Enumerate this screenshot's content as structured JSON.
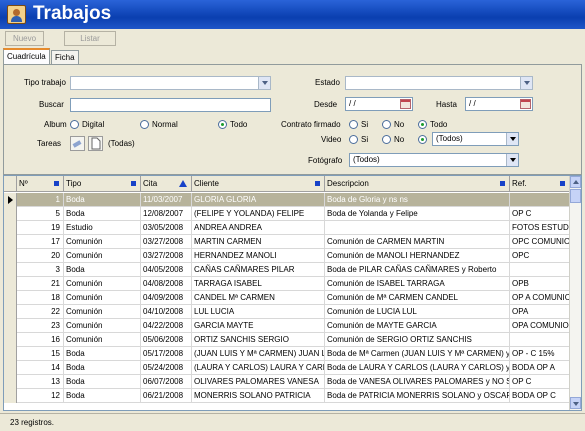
{
  "window": {
    "title": "Trabajos"
  },
  "toolbar": {
    "nuevo": "Nuevo",
    "listar": "Listar"
  },
  "tabs": [
    {
      "label": "Cuadrícula",
      "active": true
    },
    {
      "label": "Ficha",
      "active": false
    }
  ],
  "filters": {
    "tipo_trabajo_label": "Tipo trabajo",
    "tipo_trabajo_value": "",
    "estado_label": "Estado",
    "estado_value": "",
    "buscar_label": "Buscar",
    "buscar_value": "",
    "desde_label": "Desde",
    "desde_value": "/ /",
    "hasta_label": "Hasta",
    "hasta_value": "/ /",
    "album_label": "Album",
    "album_options": [
      "Digital",
      "Normal",
      "Todo"
    ],
    "album_selected": "Todo",
    "contrato_label": "Contrato firmado",
    "contrato_options": [
      "Si",
      "No",
      "Todo"
    ],
    "contrato_selected": "Todo",
    "video_label": "Video",
    "video_options": [
      "Si",
      "No"
    ],
    "video_select_value": "(Todos)",
    "tareas_label": "Tareas",
    "tareas_value": "(Todas)",
    "fotografo_label": "Fotógrafo",
    "fotografo_value": "(Todos)"
  },
  "grid": {
    "headers": [
      "Nº",
      "Tipo",
      "Cita",
      "Cliente",
      "Descripcion",
      "Ref."
    ],
    "sort_column": "Cita",
    "rows": [
      {
        "n": "1",
        "tipo": "Boda",
        "cita": "11/03/2007",
        "cliente": "GLORIA GLORIA",
        "desc": "Boda de Gloria  y ns ns",
        "ref": "",
        "selected": true
      },
      {
        "n": "5",
        "tipo": "Boda",
        "cita": "12/08/2007",
        "cliente": "(FELIPE Y YOLANDA) FELIPE",
        "desc": "Boda de Yolanda  y Felipe",
        "ref": "OP C"
      },
      {
        "n": "19",
        "tipo": "Estudio",
        "cita": "03/05/2008",
        "cliente": "ANDREA ANDREA",
        "desc": "",
        "ref": "FOTOS ESTUDIO"
      },
      {
        "n": "17",
        "tipo": "Comunión",
        "cita": "03/27/2008",
        "cliente": "MARTIN CARMEN",
        "desc": "Comunión de CARMEN MARTIN",
        "ref": "OPC COMUNIO"
      },
      {
        "n": "20",
        "tipo": "Comunión",
        "cita": "03/27/2008",
        "cliente": "HERNANDEZ MANOLI",
        "desc": "Comunión de MANOLI HERNANDEZ",
        "ref": "OPC"
      },
      {
        "n": "3",
        "tipo": "Boda",
        "cita": "04/05/2008",
        "cliente": "CAÑAS CAÑMARES PILAR",
        "desc": "Boda de PILAR CAÑAS CAÑMARES y Roberto",
        "ref": ""
      },
      {
        "n": "21",
        "tipo": "Comunión",
        "cita": "04/08/2008",
        "cliente": "TARRAGA ISABEL",
        "desc": "Comunión de ISABEL TARRAGA",
        "ref": "OPB"
      },
      {
        "n": "18",
        "tipo": "Comunión",
        "cita": "04/09/2008",
        "cliente": "CANDEL Mª CARMEN",
        "desc": "Comunión de Mª CARMEN CANDEL",
        "ref": "OP A COMUNIC"
      },
      {
        "n": "22",
        "tipo": "Comunión",
        "cita": "04/10/2008",
        "cliente": "LUL LUCIA",
        "desc": "Comunión de LUCIA LUL",
        "ref": "OPA"
      },
      {
        "n": "23",
        "tipo": "Comunión",
        "cita": "04/22/2008",
        "cliente": "GARCIA MAYTE",
        "desc": "Comunión de MAYTE GARCIA",
        "ref": "OPA  COMUNIO"
      },
      {
        "n": "16",
        "tipo": "Comunión",
        "cita": "05/06/2008",
        "cliente": "ORTIZ SANCHIS SERGIO",
        "desc": "Comunión de SERGIO ORTIZ SANCHIS",
        "ref": ""
      },
      {
        "n": "15",
        "tipo": "Boda",
        "cita": "05/17/2008",
        "cliente": "(JUAN LUIS Y Mª CARMEN) JUAN LU",
        "desc": "Boda de Mª Carmen (JUAN LUIS Y Mª CARMEN) y Ju",
        "ref": "OP - C 15%"
      },
      {
        "n": "14",
        "tipo": "Boda",
        "cita": "05/24/2008",
        "cliente": "(LAURA Y CARLOS) LAURA Y CARL",
        "desc": "Boda de LAURA Y CARLOS (LAURA Y CARLOS) y",
        "ref": "BODA OP A"
      },
      {
        "n": "13",
        "tipo": "Boda",
        "cita": "06/07/2008",
        "cliente": "OLIVARES PALOMARES VANESA",
        "desc": "Boda de VANESA OLIVARES PALOMARES y NO SE",
        "ref": "OP C"
      },
      {
        "n": "12",
        "tipo": "Boda",
        "cita": "06/21/2008",
        "cliente": "MONERRIS SOLANO PATRICIA",
        "desc": "Boda de PATRICIA MONERRIS SOLANO y OSCAR n",
        "ref": "BODA OP C"
      }
    ]
  },
  "status": {
    "text": "23 registros."
  },
  "colors": {
    "title_bar": "#1f56c8",
    "selected_row": "#b7b39b",
    "header_marker": "#1742c8"
  },
  "icons": [
    "app-icon",
    "calendar-icon",
    "eraser-icon",
    "document-icon",
    "sort-asc-icon",
    "scroll-up-icon",
    "scroll-down-icon"
  ]
}
